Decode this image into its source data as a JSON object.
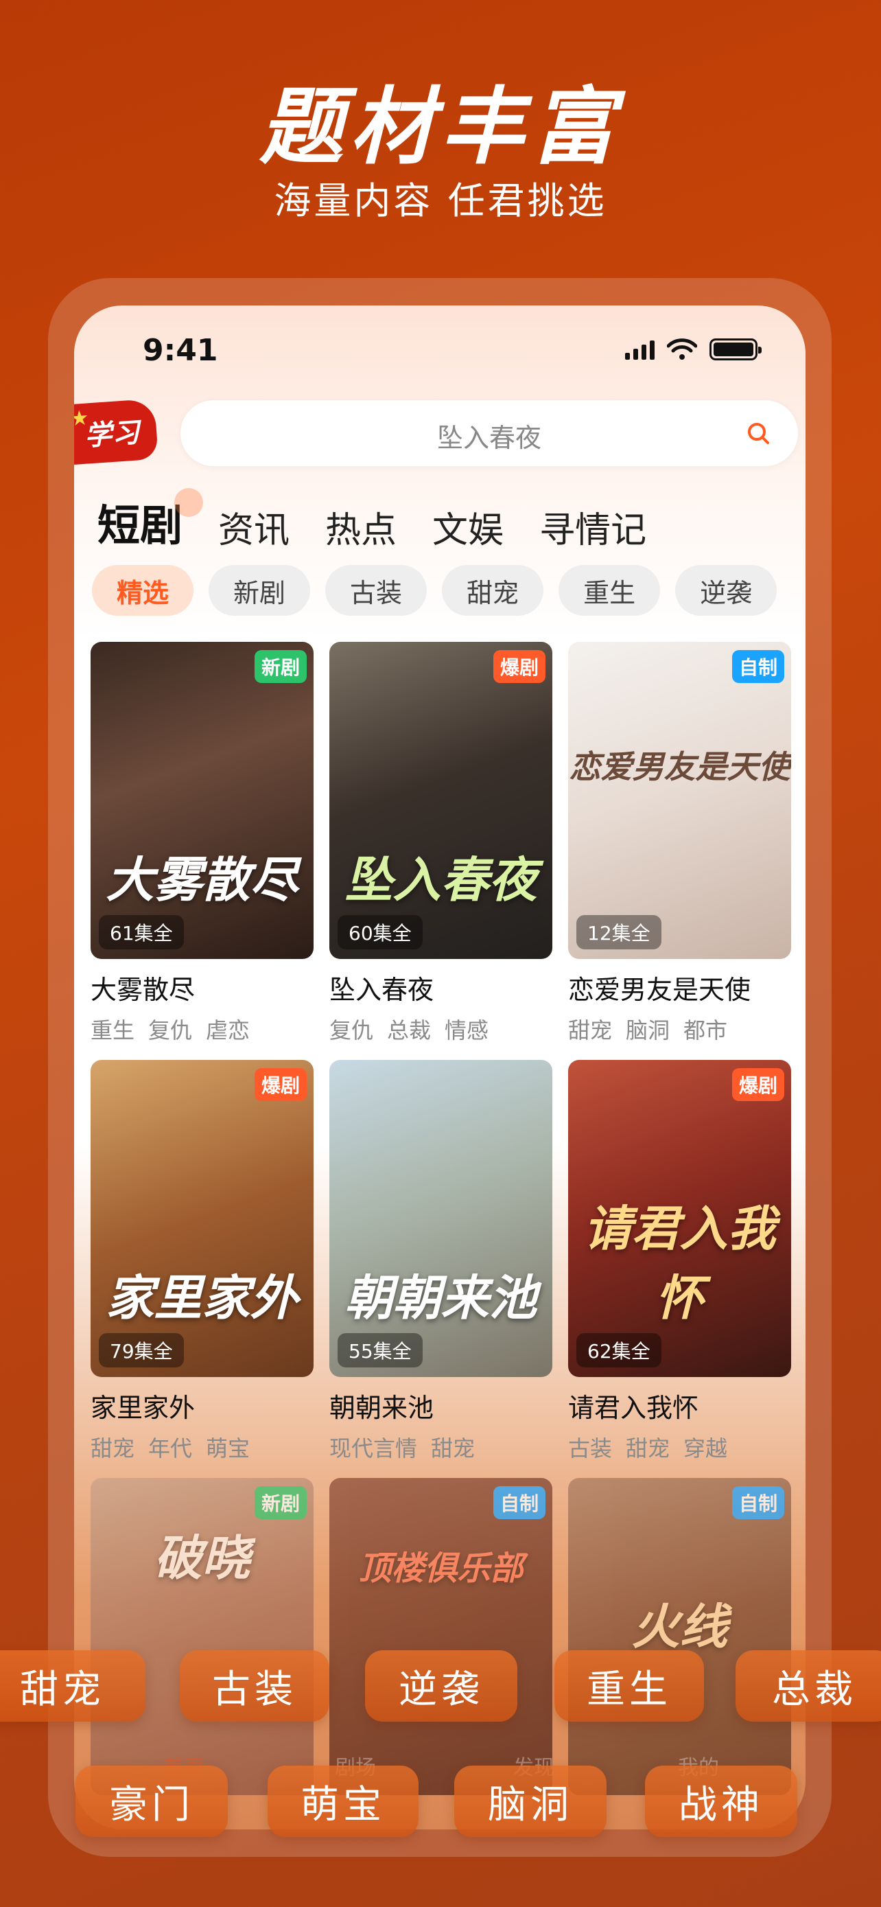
{
  "hero": {
    "title": "题材丰富",
    "subtitle": "海量内容 任君挑选"
  },
  "status": {
    "time": "9:41"
  },
  "logo": {
    "mark": "学习"
  },
  "search": {
    "text": "坠入春夜"
  },
  "tabs": [
    "短剧",
    "资讯",
    "热点",
    "文娱",
    "寻情记"
  ],
  "chips": [
    "精选",
    "新剧",
    "古装",
    "甜宠",
    "重生",
    "逆袭"
  ],
  "colors": {
    "accent": "#ff5a1f",
    "badge_new": "#2cc36b",
    "badge_hot": "#ff5a2a",
    "badge_self": "#1aa3ff"
  },
  "cards": [
    {
      "title": "大雾散尽",
      "badge": "新剧",
      "episodes": "61集全",
      "art": "大雾散尽",
      "tags": [
        "重生",
        "复仇",
        "虐恋"
      ]
    },
    {
      "title": "坠入春夜",
      "badge": "爆剧",
      "episodes": "60集全",
      "art": "坠入春夜",
      "tags": [
        "复仇",
        "总裁",
        "情感"
      ]
    },
    {
      "title": "恋爱男友是天使",
      "badge": "自制",
      "episodes": "12集全",
      "art": "恋爱男友是天使",
      "tags": [
        "甜宠",
        "脑洞",
        "都市"
      ]
    },
    {
      "title": "家里家外",
      "badge": "爆剧",
      "episodes": "79集全",
      "art": "家里家外",
      "tags": [
        "甜宠",
        "年代",
        "萌宝"
      ]
    },
    {
      "title": "朝朝来池",
      "badge": "",
      "episodes": "55集全",
      "art": "朝朝来池",
      "tags": [
        "现代言情",
        "甜宠"
      ]
    },
    {
      "title": "请君入我怀",
      "badge": "爆剧",
      "episodes": "62集全",
      "art": "请君入我怀",
      "tags": [
        "古装",
        "甜宠",
        "穿越"
      ]
    },
    {
      "title": "",
      "badge": "新剧",
      "episodes": "",
      "art": "破晓",
      "tags": []
    },
    {
      "title": "",
      "badge": "自制",
      "episodes": "",
      "art": "顶楼俱乐部",
      "tags": []
    },
    {
      "title": "",
      "badge": "自制",
      "episodes": "",
      "art": "火线",
      "tags": []
    }
  ],
  "genre_pills_row1": [
    "甜宠",
    "古装",
    "逆袭",
    "重生",
    "总裁"
  ],
  "genre_pills_row2": [
    "豪门",
    "萌宝",
    "脑洞",
    "战神"
  ],
  "bottom_nav": [
    "首页",
    "剧场",
    "发现",
    "我的"
  ]
}
